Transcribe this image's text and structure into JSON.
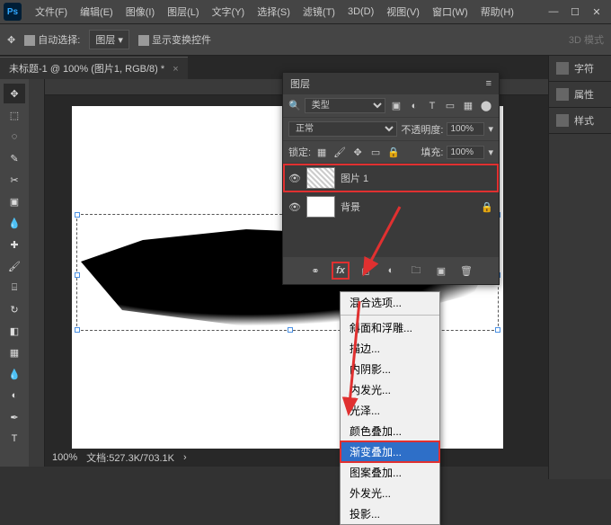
{
  "menu": {
    "items": [
      "文件(F)",
      "编辑(E)",
      "图像(I)",
      "图层(L)",
      "文字(Y)",
      "选择(S)",
      "滤镜(T)",
      "3D(D)",
      "视图(V)",
      "窗口(W)",
      "帮助(H)"
    ]
  },
  "optbar": {
    "autoselect": "自动选择:",
    "layer": "图层",
    "showcontrols": "显示变换控件",
    "mode3d": "3D 模式"
  },
  "tab": {
    "title": "未标题-1 @ 100% (图片1, RGB/8) *"
  },
  "status": {
    "zoom": "100%",
    "docsize": "文档:527.3K/703.1K"
  },
  "rpanel": {
    "char": "字符",
    "props": "属性",
    "styles": "样式"
  },
  "layers": {
    "title": "图层",
    "filter": "类型",
    "blend": "正常",
    "opacity_label": "不透明度:",
    "opacity": "100%",
    "lock": "锁定:",
    "fill_label": "填充:",
    "fill": "100%",
    "items": [
      {
        "name": "图片 1"
      },
      {
        "name": "背景"
      }
    ]
  },
  "fxmenu": {
    "items": [
      "混合选项...",
      "斜面和浮雕...",
      "描边...",
      "内阴影...",
      "内发光...",
      "光泽...",
      "颜色叠加...",
      "渐变叠加...",
      "图案叠加...",
      "外发光...",
      "投影..."
    ],
    "selected": 7
  }
}
